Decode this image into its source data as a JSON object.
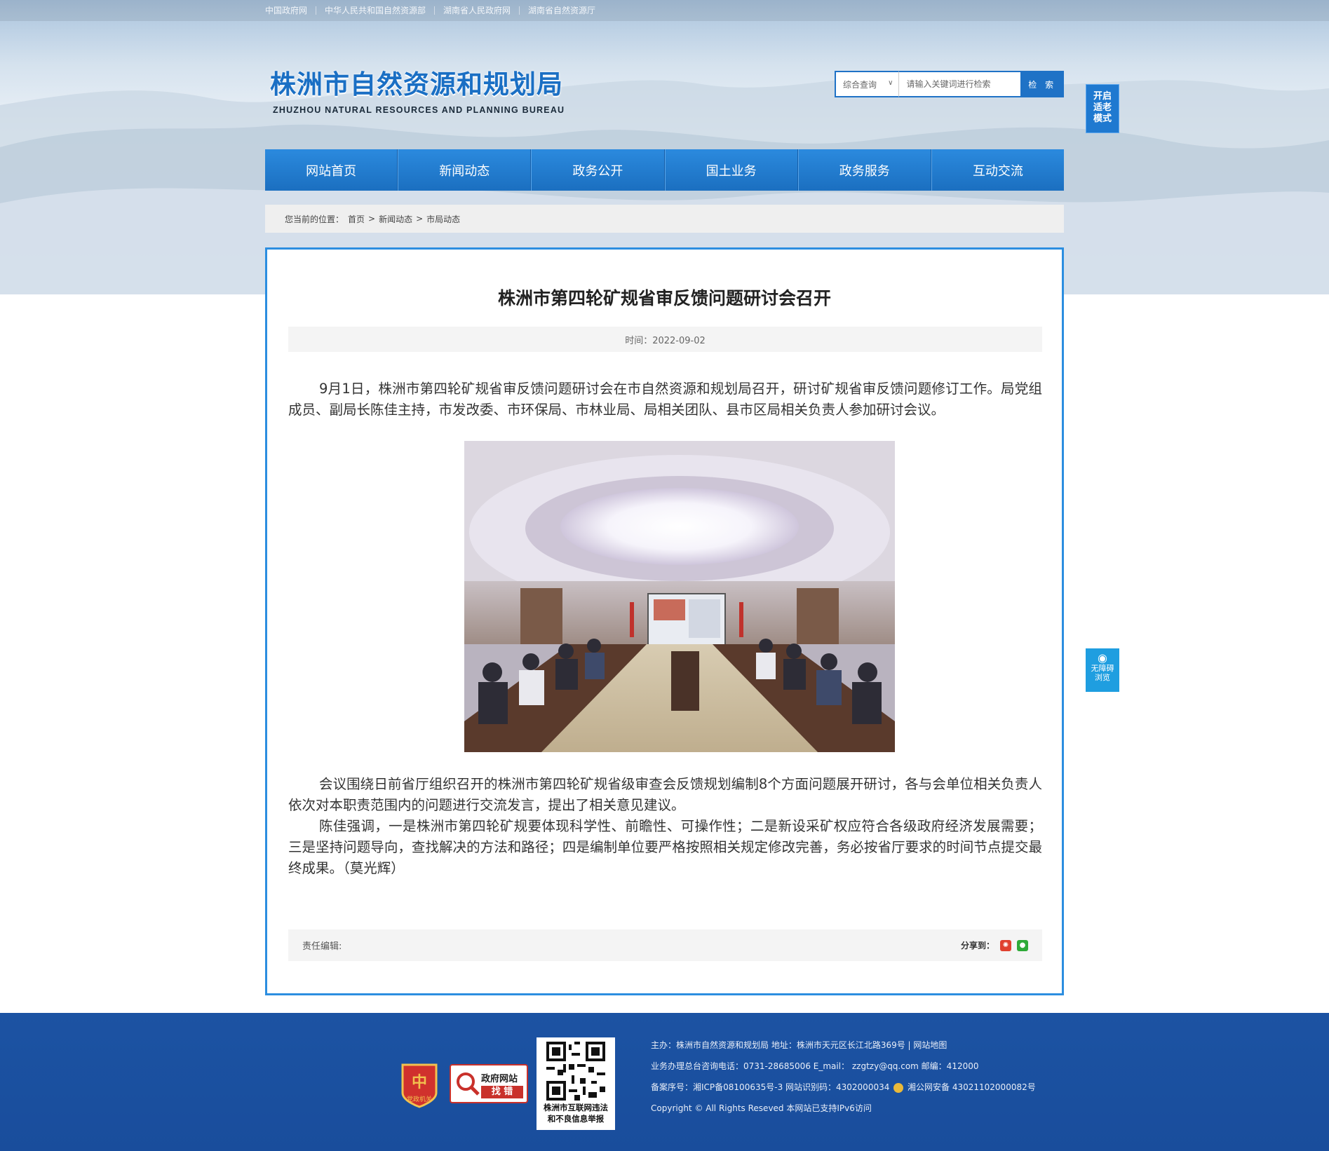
{
  "top_links": [
    {
      "label": "中国政府网"
    },
    {
      "label": "中华人民共和国自然资源部"
    },
    {
      "label": "湖南省人民政府网"
    },
    {
      "label": "湖南省自然资源厅"
    }
  ],
  "logo": {
    "cn": "株洲市自然资源和规划局",
    "en": "ZHUZHOU NATURAL RESOURCES AND PLANNING BUREAU"
  },
  "search": {
    "type_label": "综合查询",
    "placeholder": "请输入关键词进行检索",
    "button": "检 索"
  },
  "elder_mode": {
    "line1": "开启",
    "line2": "适老",
    "line3": "模式"
  },
  "nav": [
    {
      "label": "网站首页"
    },
    {
      "label": "新闻动态"
    },
    {
      "label": "政务公开"
    },
    {
      "label": "国土业务"
    },
    {
      "label": "政务服务"
    },
    {
      "label": "互动交流"
    }
  ],
  "breadcrumb": {
    "prefix": "您当前的位置：",
    "items": [
      {
        "label": "首页"
      },
      {
        "label": "新闻动态"
      },
      {
        "label": "市局动态"
      }
    ],
    "separator": ">"
  },
  "article": {
    "title": "株洲市第四轮矿规省审反馈问题研讨会召开",
    "time": "时间：2022-09-02",
    "paragraphs": [
      "9月1日，株洲市第四轮矿规省审反馈问题研讨会在市自然资源和规划局召开，研讨矿规省审反馈问题修订工作。局党组成员、副局长陈佳主持，市发改委、市环保局、市林业局、局相关团队、县市区局相关负责人参加研讨会议。",
      "会议围绕日前省厅组织召开的株洲市第四轮矿规省级审查会反馈规划编制8个方面问题展开研讨，各与会单位相关负责人依次对本职责范围内的问题进行交流发言，提出了相关意见建议。",
      "陈佳强调，一是株洲市第四轮矿规要体现科学性、前瞻性、可操作性；二是新设采矿权应符合各级政府经济发展需要；三是坚持问题导向，查找解决的方法和路径；四是编制单位要严格按照相关规定修改完善，务必按省厅要求的时间节点提交最终成果。（莫光辉）"
    ],
    "editor_label": "责任编辑:",
    "share_label": "分享到："
  },
  "accessibility": {
    "line1": "无障碍",
    "line2": "浏览"
  },
  "footer": {
    "gov_badge_line1": "政府网站",
    "gov_badge_line2": "找 错",
    "party_badge_text": "党政机关",
    "qr_caption_line1": "株洲市互联网违法",
    "qr_caption_line2": "和不良信息举报",
    "line1": "主办：株洲市自然资源和规划局   地址：株洲市天元区长江北路369号  |  网站地图",
    "line2": "业务办理总台咨询电话：0731-28685006    E_mail：  zzgtzy@qq.com    邮编：412000",
    "line3a": "备案序号：湘ICP备08100635号-3  网站识别码：4302000034",
    "line3b": "湘公网安备 43021102000082号",
    "line4": "Copyright © All Rights Reseved 本网站已支持IPv6访问"
  },
  "colors": {
    "primary": "#1f72c6",
    "footer_bg": "#1c53a3",
    "content_border": "#2c8ee0"
  }
}
